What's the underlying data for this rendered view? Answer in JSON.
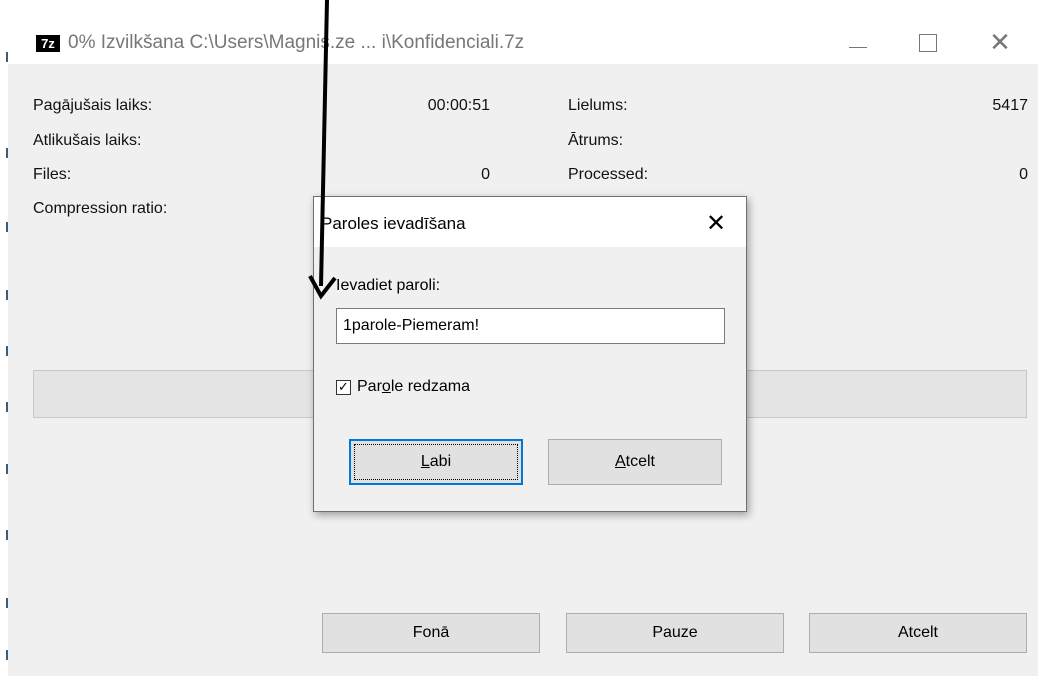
{
  "window": {
    "app_icon_text": "7z",
    "title": "0% Izvilkšana C:\\Users\\Magnis.ze ... i\\Konfidenciali.7z"
  },
  "stats": {
    "elapsed_label": "Pagājušais laiks:",
    "elapsed_value": "00:00:51",
    "remaining_label": "Atlikušais laiks:",
    "files_label": "Files:",
    "files_value": "0",
    "compression_label": "Compression ratio:",
    "size_label": "Lielums:",
    "size_value": "5417",
    "speed_label": "Ātrums:",
    "processed_label": "Processed:",
    "processed_value": "0"
  },
  "buttons": {
    "background": "Fonā",
    "pause": "Pauze",
    "cancel": "Atcelt"
  },
  "dialog": {
    "title": "Paroles ievadīšana",
    "prompt": "Ievadiet paroli:",
    "password_value": "1parole-Piemeram!",
    "show_password_pre": "Par",
    "show_password_u": "o",
    "show_password_post": "le redzama",
    "show_password_checked": true,
    "ok_u": "L",
    "ok_rest": "abi",
    "cancel_u": "A",
    "cancel_rest": "tcelt"
  },
  "colors": {
    "window_bg": "#f0f0f0",
    "titlebar_bg": "#ffffff",
    "focus_border": "#0078d7",
    "button_bg": "#e1e1e1"
  },
  "icons": [
    "7zip-app-icon",
    "minimize-icon",
    "maximize-icon",
    "close-icon",
    "checkmark-icon",
    "annotation-arrow-icon"
  ]
}
